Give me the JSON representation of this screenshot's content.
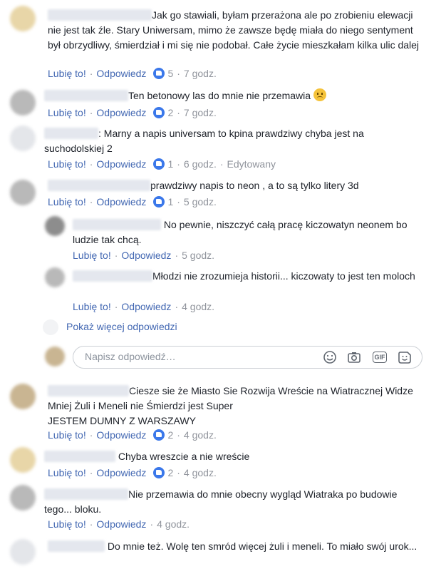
{
  "actions": {
    "like": "Lubię to!",
    "reply": "Odpowiedz",
    "edited": "Edytowany"
  },
  "comments": [
    {
      "text": "Jak go stawiali, byłam przerażona ale po zrobieniu elewacji nie jest tak źle. Stary Uniwersam, mimo że zawsze będę miała do niego sentyment był obrzydliwy, śmierdział i mi się nie podobał. Całe życie mieszkałam kilka ulic dalej",
      "likes": "5",
      "time": "7 godz."
    },
    {
      "text": "Ten betonowy las do mnie nie przemawia",
      "emoji": "confused-face",
      "likes": "2",
      "time": "7 godz."
    },
    {
      "text": ": Marny a napis universam to kpina prawdziwy chyba jest na suchodolskiej 2",
      "likes": "1",
      "time": "6 godz."
    },
    {
      "text": "prawdziwy napis to neon , a to są tylko litery 3d",
      "likes": "1",
      "time": "5 godz."
    }
  ],
  "replies": [
    {
      "text": "No pewnie, niszczyć całą pracę kiczowatyn neonem bo ludzie tak chcą.",
      "time": "5 godz."
    },
    {
      "text": "Młodzi nie zrozumieja historii... kiczowaty to jest ten moloch",
      "time": "4 godz."
    }
  ],
  "more_replies": "Pokaż więcej odpowiedzi",
  "reply_box": {
    "placeholder": "Napisz odpowiedź…",
    "icons": [
      "smiley-icon",
      "camera-icon",
      "gif-icon",
      "sticker-icon"
    ]
  },
  "lower_comments": [
    {
      "text": "Ciesze sie że Miasto Sie Rozwija Wreście na Wiatracznej Widze Mniej Żuli i Meneli nie Śmierdzi jest Super",
      "line3": "JESTEM DUMNY Z WARSZAWY",
      "likes": "2",
      "time": "4 godz."
    },
    {
      "text": "Chyba wreszcie a nie wreście",
      "likes": "2",
      "time": "4 godz."
    },
    {
      "text": "Nie przemawia do mnie obecny wygląd Wiatraka po budowie tego... bloku.",
      "time": "4 godz."
    },
    {
      "text": "Do mnie też. Wolę ten smród więcej żuli i meneli. To miało swój urok..."
    }
  ]
}
